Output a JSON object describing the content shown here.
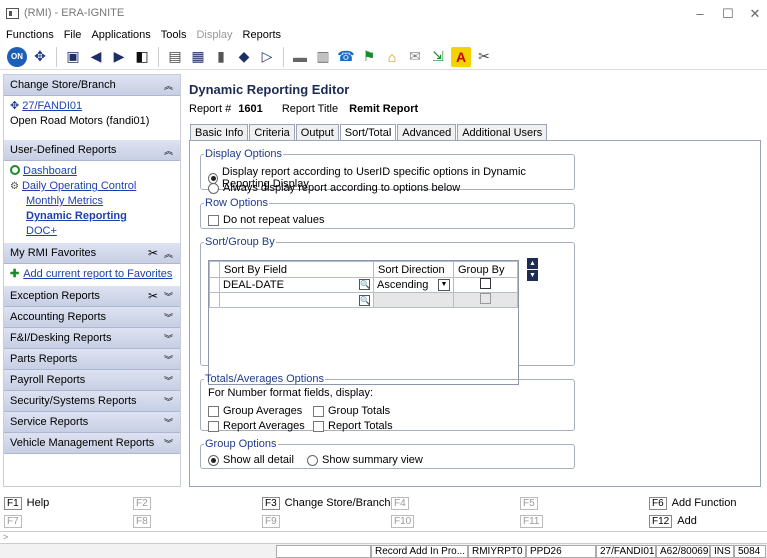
{
  "window": {
    "title": "(RMI) - ERA-IGNITE",
    "minimize": "–",
    "maximize": "☐",
    "close": "✕"
  },
  "menu": {
    "functions": "Functions",
    "file": "File",
    "applications": "Applications",
    "tools": "Tools",
    "display": "Display",
    "reports": "Reports"
  },
  "sidebar": {
    "change_store_header": "Change Store/Branch",
    "store_link": "27/FANDI01",
    "store_name": "Open Road Motors (fandi01)",
    "user_defined_header": "User-Defined Reports",
    "user_defined_items": [
      "Dashboard",
      "Daily Operating Control",
      "Monthly Metrics",
      "Dynamic Reporting",
      "DOC+"
    ],
    "favorites_header": "My RMI Favorites",
    "add_favorite": "Add current report to Favorites",
    "sections": [
      "Exception Reports",
      "Accounting Reports",
      "F&I/Desking Reports",
      "Parts Reports",
      "Payroll Reports",
      "Security/Systems Reports",
      "Service Reports",
      "Vehicle Management Reports"
    ]
  },
  "editor": {
    "title": "Dynamic Reporting Editor",
    "report_num_label": "Report #",
    "report_num": "1601",
    "report_title_label": "Report Title",
    "report_title": "Remit Report",
    "tabs": [
      "Basic Info",
      "Criteria",
      "Output",
      "Sort/Total",
      "Advanced",
      "Additional Users"
    ],
    "active_tab": "Sort/Total"
  },
  "display_options": {
    "legend": "Display Options",
    "opt1": "Display report according to UserID specific options in Dynamic Reporting Display",
    "opt2": "Always display report according to options below"
  },
  "row_options": {
    "legend": "Row Options",
    "no_repeat": "Do not repeat values"
  },
  "sort_group": {
    "legend": "Sort/Group By",
    "col_field": "Sort By Field",
    "col_direction": "Sort Direction",
    "col_group": "Group By",
    "rows": [
      {
        "field": "DEAL-DATE",
        "direction": "Ascending"
      },
      {
        "field": "",
        "direction": ""
      }
    ]
  },
  "totals": {
    "legend": "Totals/Averages Options",
    "intro": "For Number format fields, display:",
    "group_averages": "Group Averages",
    "group_totals": "Group Totals",
    "report_averages": "Report Averages",
    "report_totals": "Report Totals"
  },
  "group_options": {
    "legend": "Group Options",
    "show_all": "Show all detail",
    "show_summary": "Show summary view"
  },
  "fkeys": {
    "f1": "F1",
    "f1_label": "Help",
    "f2": "F2",
    "f3": "F3",
    "f3_label": "Change Store/Branch",
    "f4": "F4",
    "f5": "F5",
    "f6": "F6",
    "f6_label": "Add Function",
    "f7": "F7",
    "f8": "F8",
    "f9": "F9",
    "f10": "F10",
    "f11": "F11",
    "f12": "F12",
    "f12_label": "Add",
    "prompt": ">"
  },
  "status": {
    "mode": "Record Add In Pro...",
    "program": "RMIYRPT0",
    "code": "PPD26",
    "store": "27/FANDI01",
    "terminal": "A62/80069",
    "ins": "INS",
    "port": "5084"
  }
}
